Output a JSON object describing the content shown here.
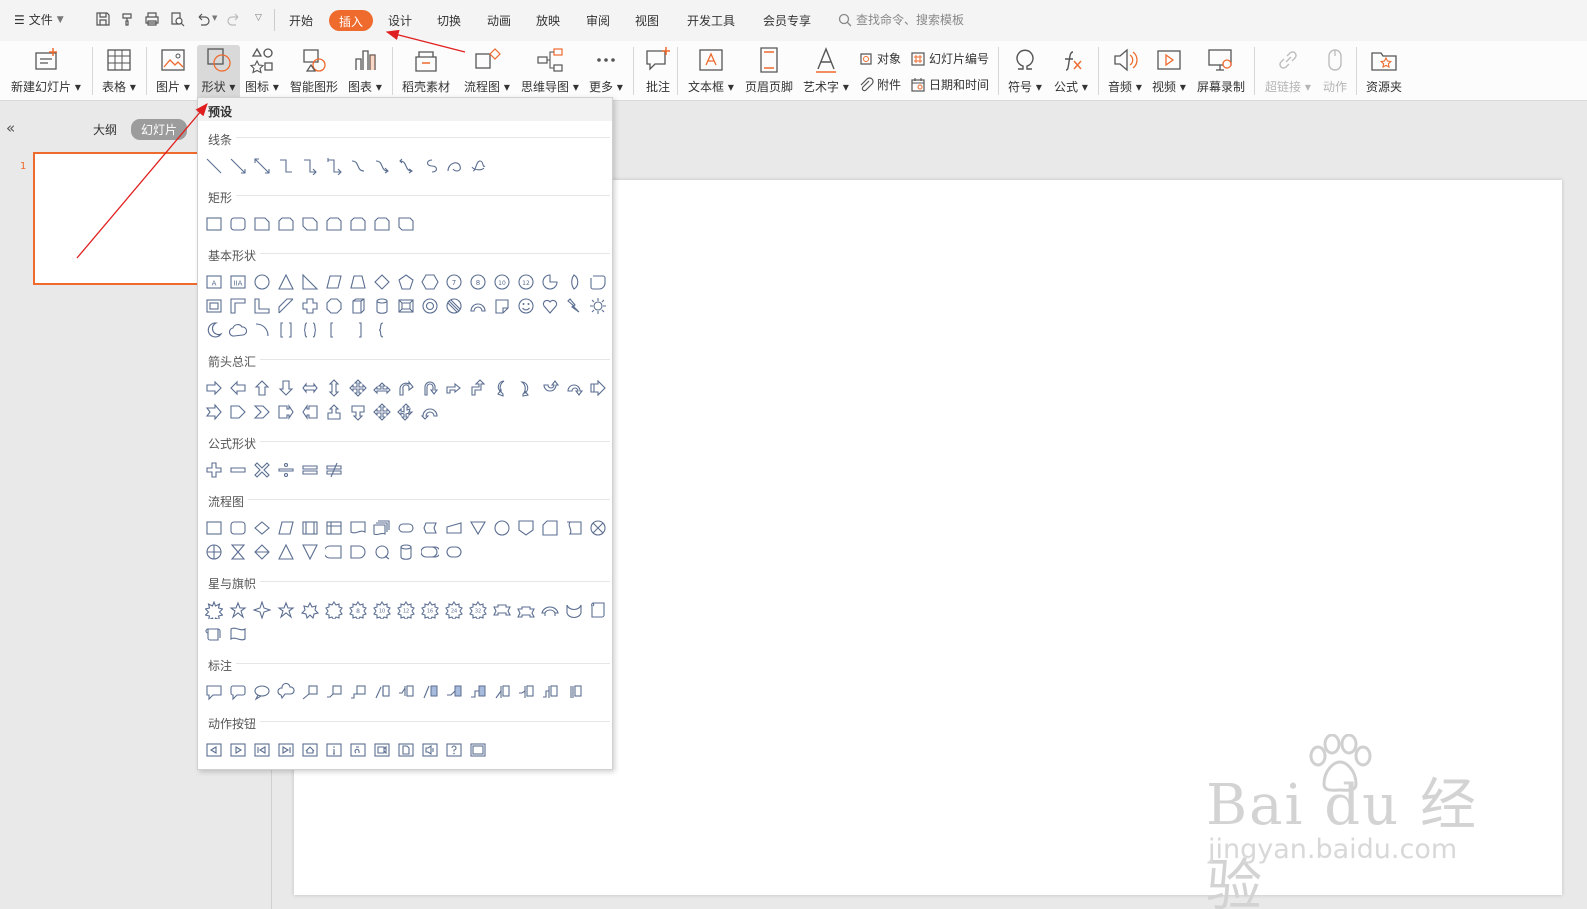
{
  "menubar": {
    "file_label": "文件",
    "tabs": [
      "开始",
      "插入",
      "设计",
      "切换",
      "动画",
      "放映",
      "审阅",
      "视图",
      "开发工具",
      "会员专享"
    ],
    "active_tab": "插入",
    "search_placeholder": "查找命令、搜索模板",
    "accent": "#ee6a2d"
  },
  "ribbon": {
    "new_slide": "新建幻灯片",
    "table": "表格",
    "picture": "图片",
    "shape": "形状",
    "icon": "图标",
    "smart_art": "智能图形",
    "chart": "图表",
    "docer": "稻壳素材",
    "flowchart": "流程图",
    "mindmap": "思维导图",
    "more": "更多",
    "comment": "批注",
    "textbox": "文本框",
    "header_footer": "页眉页脚",
    "wordart": "艺术字",
    "object": "对象",
    "attachment": "附件",
    "slide_number": "幻灯片编号",
    "date_time": "日期和时间",
    "symbol": "符号",
    "formula": "公式",
    "audio": "音频",
    "video": "视频",
    "screen_record": "屏幕录制",
    "hyperlink": "超链接",
    "action": "动作",
    "resources": "资源夹"
  },
  "left_panel": {
    "outline_tab": "大纲",
    "slides_tab": "幻灯片",
    "slide_number": "1"
  },
  "shapes_panel": {
    "preset": "预设",
    "sections": [
      {
        "title": "线条",
        "count": 12
      },
      {
        "title": "矩形",
        "count": 9
      },
      {
        "title": "基本形状",
        "count": 42
      },
      {
        "title": "箭头总汇",
        "count": 27
      },
      {
        "title": "公式形状",
        "count": 6
      },
      {
        "title": "流程图",
        "count": 28
      },
      {
        "title": "星与旗帜",
        "count": 19
      },
      {
        "title": "标注",
        "count": 16
      },
      {
        "title": "动作按钮",
        "count": 12
      }
    ]
  },
  "watermark": {
    "logo": "Bai du 经验",
    "url": "jingyan.baidu.com"
  }
}
